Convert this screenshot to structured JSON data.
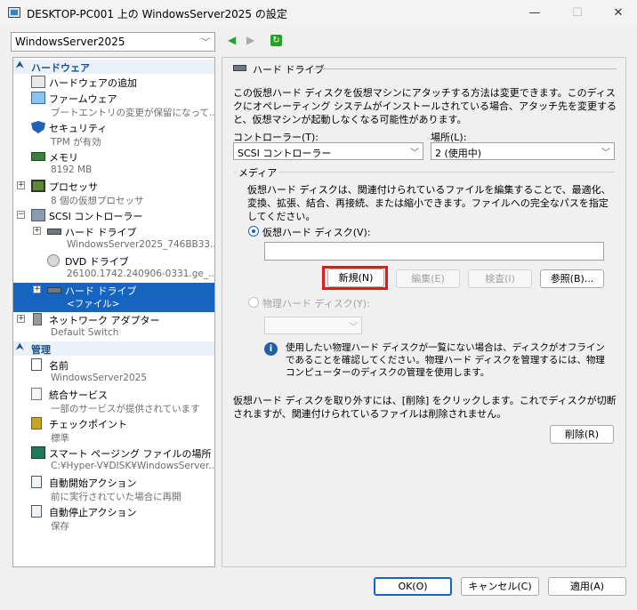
{
  "window": {
    "title": "DESKTOP-PC001 上の WindowsServer2025 の設定",
    "minimize": "—",
    "maximize": "☐",
    "close": "✕"
  },
  "vm_selector": {
    "value": "WindowsServer2025"
  },
  "nav": {
    "back": "◀",
    "forward": "▶",
    "refresh": "↻"
  },
  "sidebar": {
    "hardware_header": "ハードウェア",
    "management_header": "管理",
    "hardware_items": [
      {
        "label": "ハードウェアの追加",
        "sub": ""
      },
      {
        "label": "ファームウェア",
        "sub": "ブートエントリの変更が保留になって..."
      },
      {
        "label": "セキュリティ",
        "sub": "TPM が有効"
      },
      {
        "label": "メモリ",
        "sub": "8192 MB"
      },
      {
        "label": "プロセッサ",
        "sub": "8 個の仮想プロセッサ"
      },
      {
        "label": "SCSI コントローラー",
        "sub": ""
      },
      {
        "label": "ハード ドライブ",
        "sub": "WindowsServer2025_746BB33..."
      },
      {
        "label": "DVD ドライブ",
        "sub": "26100.1742.240906-0331.ge_..."
      },
      {
        "label": "ハード ドライブ",
        "sub": "<ファイル>"
      },
      {
        "label": "ネットワーク アダプター",
        "sub": "Default Switch"
      }
    ],
    "management_items": [
      {
        "label": "名前",
        "sub": "WindowsServer2025"
      },
      {
        "label": "統合サービス",
        "sub": "一部のサービスが提供されています"
      },
      {
        "label": "チェックポイント",
        "sub": "標準"
      },
      {
        "label": "スマート ページング ファイルの場所",
        "sub": "C:¥Hyper-V¥DISK¥WindowsServer..."
      },
      {
        "label": "自動開始アクション",
        "sub": "前に実行されていた場合に再開"
      },
      {
        "label": "自動停止アクション",
        "sub": "保存"
      }
    ]
  },
  "panel": {
    "header": "ハード ドライブ",
    "description": "この仮想ハード ディスクを仮想マシンにアタッチする方法は変更できます。このディスクにオペレーティング システムがインストールされている場合、アタッチ先を変更すると、仮想マシンが起動しなくなる可能性があります。",
    "controller_label": "コントローラー(T):",
    "controller_value": "SCSI コントローラー",
    "location_label": "場所(L):",
    "location_value": "2 (使用中)",
    "media_label": "メディア",
    "media_description": "仮想ハード ディスクは、関連付けられているファイルを編集することで、最適化、変換、拡張、結合、再接続、または縮小できます。ファイルへの完全なパスを指定してください。",
    "vhd_radio_label": "仮想ハード ディスク(V):",
    "vhd_path_value": "",
    "btn_new": "新規(N)",
    "btn_edit": "編集(E)",
    "btn_inspect": "検査(I)",
    "btn_browse": "参照(B)...",
    "physical_radio_label": "物理ハード ディスク(Y):",
    "physical_value": "",
    "info_text": "使用したい物理ハード ディスクが一覧にない場合は、ディスクがオフラインであることを確認してください。物理ハード ディスクを管理するには、物理コンピューターのディスクの管理を使用します。",
    "remove_description": "仮想ハード ディスクを取り外すには、[削除] をクリックします。これでディスクが切断されますが、関連付けられているファイルは削除されません。",
    "btn_remove": "削除(R)"
  },
  "footer": {
    "ok": "OK(O)",
    "cancel": "キャンセル(C)",
    "apply": "適用(A)"
  }
}
